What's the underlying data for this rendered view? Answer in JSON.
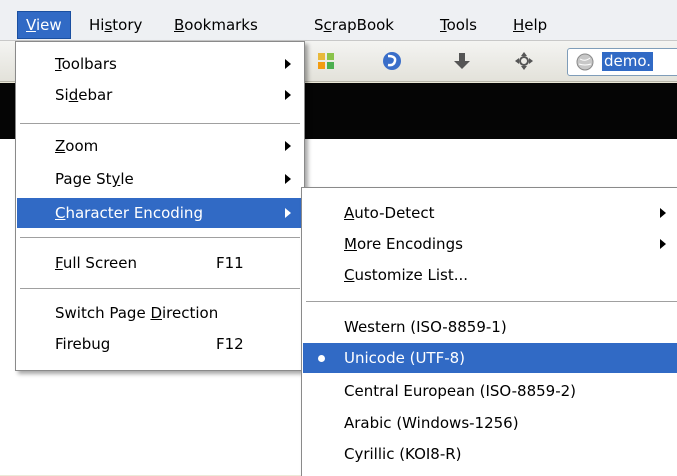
{
  "menubar": {
    "items": [
      {
        "label": "View",
        "active": true
      },
      {
        "label": "History"
      },
      {
        "label": "Bookmarks"
      },
      {
        "label": "ScrapBook"
      },
      {
        "label": "Tools"
      },
      {
        "label": "Help"
      }
    ]
  },
  "toolbar": {
    "url_text": "demo."
  },
  "view_menu": {
    "items": [
      {
        "label": "Toolbars",
        "submenu": true
      },
      {
        "label": "Sidebar",
        "submenu": true
      },
      {
        "label": "Zoom",
        "submenu": true
      },
      {
        "label": "Page Style",
        "submenu": true
      },
      {
        "label": "Character Encoding",
        "submenu": true,
        "highlighted": true
      },
      {
        "label": "Full Screen",
        "accel": "F11"
      },
      {
        "label": "Switch Page Direction"
      },
      {
        "label": "Firebug",
        "accel": "F12"
      }
    ]
  },
  "encoding_menu": {
    "items": [
      {
        "label": "Auto-Detect",
        "submenu": true
      },
      {
        "label": "More Encodings",
        "submenu": true
      },
      {
        "label": "Customize List..."
      },
      {
        "label": "Western (ISO-8859-1)"
      },
      {
        "label": "Unicode (UTF-8)",
        "checked": true,
        "highlighted": true
      },
      {
        "label": "Central European (ISO-8859-2)"
      },
      {
        "label": "Arabic (Windows-1256)"
      },
      {
        "label": "Cyrillic (KOI8-R)"
      }
    ]
  },
  "colors": {
    "highlight": "#316ac5",
    "menu_bg": "#ffffff"
  }
}
